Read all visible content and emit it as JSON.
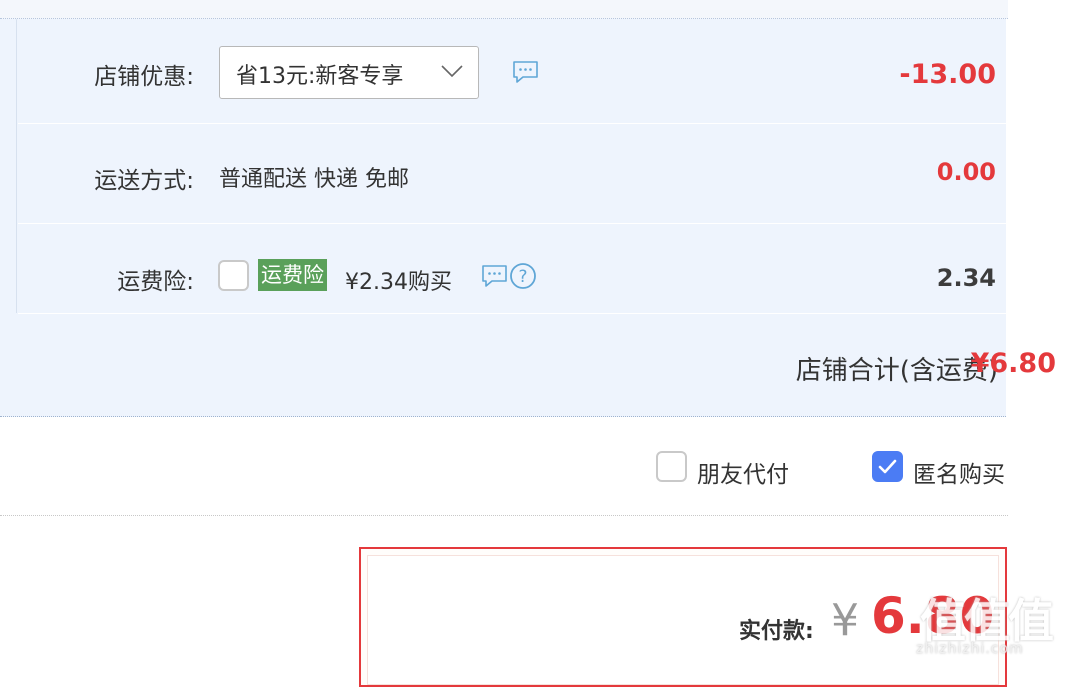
{
  "shop_discount": {
    "label": "店铺优惠:",
    "selected": "省13元:新客专享",
    "amount": "-13.00"
  },
  "shipping": {
    "label": "运送方式:",
    "method": "普通配送 快递 免邮",
    "amount": "0.00"
  },
  "insurance": {
    "label": "运费险:",
    "tag": "运费险",
    "price_text": "¥2.34购买",
    "amount": "2.34",
    "checked": false
  },
  "shop_total": {
    "label": "店铺合计(含运费)",
    "amount": "¥6.80"
  },
  "options": {
    "friend_pay": {
      "label": "朋友代付",
      "checked": false
    },
    "anonymous": {
      "label": "匿名购买",
      "checked": true
    }
  },
  "payment": {
    "label": "实付款:",
    "currency": "¥",
    "amount": "6.80"
  },
  "watermark": {
    "logo": "值值值",
    "site": "zhizhizhi.com"
  },
  "colors": {
    "accent_red": "#e4393c",
    "panel_bg": "#eef4fd",
    "check_blue": "#4b7cf4",
    "tag_green": "#5aa05a"
  }
}
